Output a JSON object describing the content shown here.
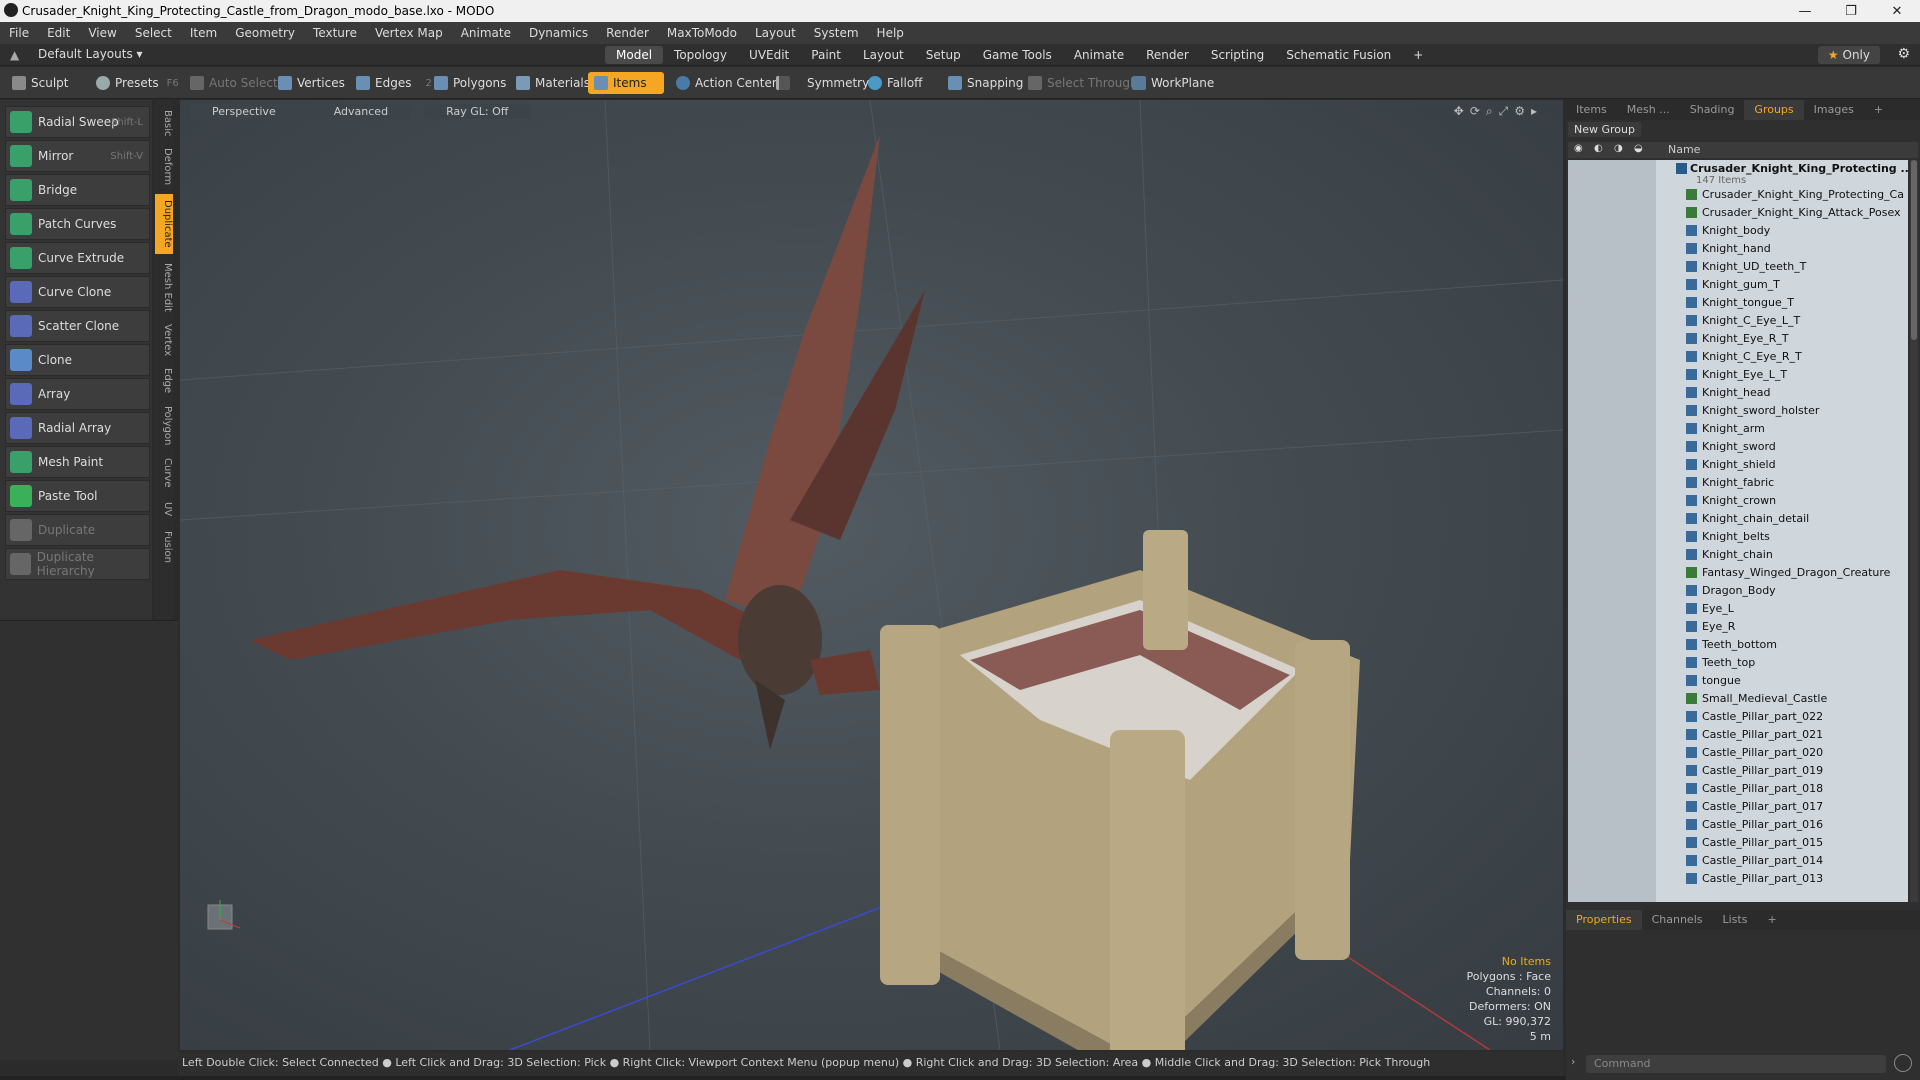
{
  "window": {
    "title": "Crusader_Knight_King_Protecting_Castle_from_Dragon_modo_base.lxo - MODO"
  },
  "menu": [
    "File",
    "Edit",
    "View",
    "Select",
    "Item",
    "Geometry",
    "Texture",
    "Vertex Map",
    "Animate",
    "Dynamics",
    "Render",
    "MaxToModo",
    "Layout",
    "System",
    "Help"
  ],
  "layoutbar": {
    "layouts_label": "Default Layouts ▾",
    "tabs": [
      "Model",
      "Topology",
      "UVEdit",
      "Paint",
      "Layout",
      "Setup",
      "Game Tools",
      "Animate",
      "Render",
      "Scripting",
      "Schematic Fusion",
      "+"
    ],
    "active_tab": "Model",
    "only_label": "Only"
  },
  "toolbar": {
    "sculpt": "Sculpt",
    "presets": "Presets",
    "presets_key": "F6",
    "auto_select": "Auto Select",
    "vertices": "Vertices",
    "vertices_count": "1",
    "edges": "Edges",
    "edges_count": "2",
    "polygons": "Polygons",
    "materials": "Materials",
    "items": "Items",
    "action_center": "Action Center",
    "symmetry": "Symmetry",
    "falloff": "Falloff",
    "snapping": "Snapping",
    "select_through": "Select Through",
    "workplane": "WorkPlane"
  },
  "tools": [
    {
      "label": "Radial Sweep",
      "shortcut": "Shift-L"
    },
    {
      "label": "Mirror",
      "shortcut": "Shift-V"
    },
    {
      "label": "Bridge",
      "shortcut": ""
    },
    {
      "label": "Patch Curves",
      "shortcut": ""
    },
    {
      "label": "Curve Extrude",
      "shortcut": ""
    },
    {
      "label": "Curve Clone",
      "shortcut": ""
    },
    {
      "label": "Scatter Clone",
      "shortcut": ""
    },
    {
      "label": "Clone",
      "shortcut": ""
    },
    {
      "label": "Array",
      "shortcut": ""
    },
    {
      "label": "Radial Array",
      "shortcut": ""
    },
    {
      "label": "Mesh Paint",
      "shortcut": ""
    },
    {
      "label": "Paste Tool",
      "shortcut": ""
    },
    {
      "label": "Duplicate",
      "shortcut": ""
    },
    {
      "label": "Duplicate Hierarchy",
      "shortcut": ""
    }
  ],
  "vertical_tabs": [
    "Basic",
    "Deform",
    "Duplicate",
    "Mesh Edit",
    "Vertex",
    "Edge",
    "Polygon",
    "Curve",
    "UV",
    "Fusion"
  ],
  "viewport": {
    "perspective": "Perspective",
    "advanced": "Advanced",
    "raygl": "Ray GL: Off",
    "info": {
      "no_items": "No Items",
      "polygons": "Polygons : Face",
      "channels": "Channels: 0",
      "deformers": "Deformers: ON",
      "gl": "GL: 990,372",
      "distance": "5 m"
    }
  },
  "statusbar": "Left Double Click: Select Connected ● Left Click and Drag: 3D Selection: Pick ● Right Click: Viewport Context Menu (popup menu) ● Right Click and Drag: 3D Selection: Area ● Middle Click and Drag: 3D Selection: Pick Through",
  "rightpanel": {
    "tabs": [
      "Items",
      "Mesh ...",
      "Shading",
      "Groups",
      "Images",
      "+"
    ],
    "active_tab": "Groups",
    "new_group": "New Group",
    "name_col": "Name",
    "root": "Crusader_Knight_King_Protecting ...",
    "root_count": "147 Items",
    "items": [
      "Crusader_Knight_King_Protecting_Ca ...",
      "Crusader_Knight_King_Attack_Posex",
      "Knight_body",
      "Knight_hand",
      "Knight_UD_teeth_T",
      "Knight_gum_T",
      "Knight_tongue_T",
      "Knight_C_Eye_L_T",
      "Knight_Eye_R_T",
      "Knight_C_Eye_R_T",
      "Knight_Eye_L_T",
      "Knight_head",
      "Knight_sword_holster",
      "Knight_arm",
      "Knight_sword",
      "Knight_shield",
      "Knight_fabric",
      "Knight_crown",
      "Knight_chain_detail",
      "Knight_belts",
      "Knight_chain",
      "Fantasy_Winged_Dragon_Creature",
      "Dragon_Body",
      "Eye_L",
      "Eye_R",
      "Teeth_bottom",
      "Teeth_top",
      "tongue",
      "Small_Medieval_Castle",
      "Castle_Pillar_part_022",
      "Castle_Pillar_part_021",
      "Castle_Pillar_part_020",
      "Castle_Pillar_part_019",
      "Castle_Pillar_part_018",
      "Castle_Pillar_part_017",
      "Castle_Pillar_part_016",
      "Castle_Pillar_part_015",
      "Castle_Pillar_part_014",
      "Castle_Pillar_part_013"
    ],
    "prop_tabs": [
      "Properties",
      "Channels",
      "Lists",
      "+"
    ],
    "command_placeholder": "Command"
  },
  "colors": {
    "accent": "#f5a623",
    "viewport_bg": "#434b51",
    "tree_bg": "#cfd6dc"
  }
}
